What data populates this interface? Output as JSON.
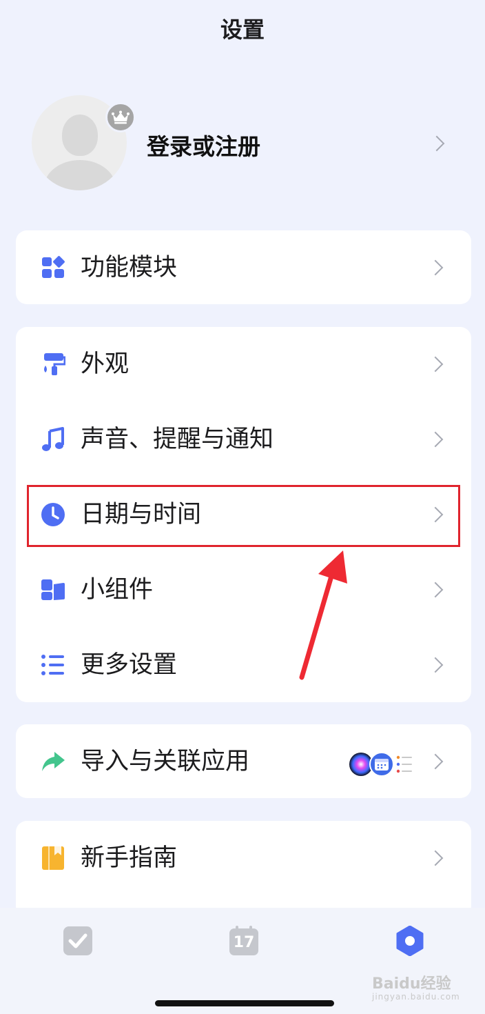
{
  "header": {
    "title": "设置"
  },
  "profile": {
    "login_label": "登录或注册"
  },
  "sections": {
    "modules": {
      "label": "功能模块"
    },
    "appearance": {
      "label": "外观"
    },
    "sound": {
      "label": "声音、提醒与通知"
    },
    "datetime": {
      "label": "日期与时间"
    },
    "widgets": {
      "label": "小组件"
    },
    "more": {
      "label": "更多设置"
    },
    "import": {
      "label": "导入与关联应用"
    },
    "guide": {
      "label": "新手指南"
    }
  },
  "tabbar": {
    "calendar_day": "17"
  },
  "watermark": {
    "main": "Baidu经验",
    "sub": "jingyan.baidu.com"
  },
  "colors": {
    "accent": "#4f6ef3",
    "background": "#eff2fd",
    "highlight": "#e0242d",
    "guide_icon": "#f7b42f",
    "import_icon": "#43c58d"
  }
}
